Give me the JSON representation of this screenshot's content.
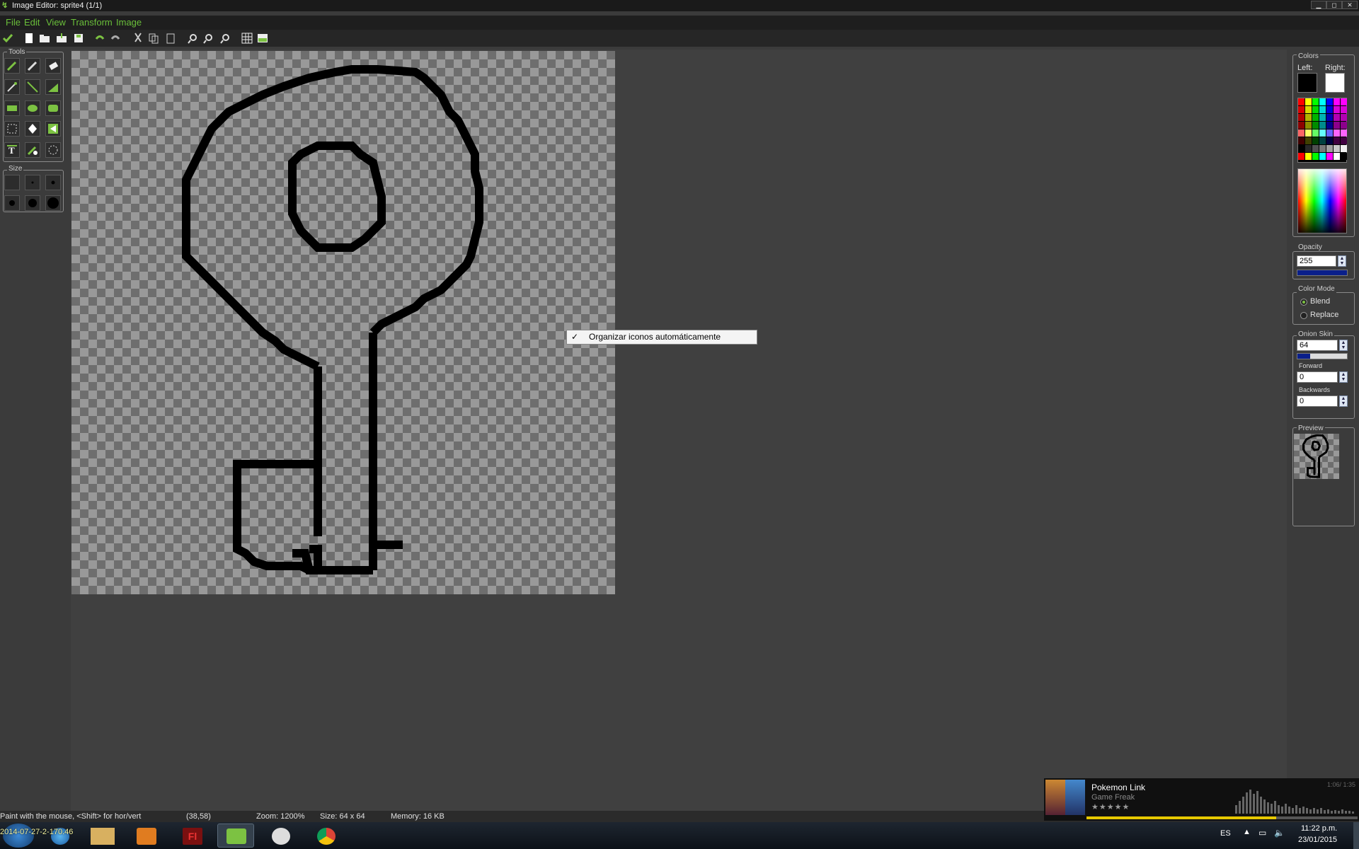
{
  "window": {
    "title": "Image Editor: sprite4 (1/1)",
    "controls": [
      "▁",
      "◻",
      "✕"
    ]
  },
  "menu": [
    "File",
    "Edit",
    "View",
    "Transform",
    "Image"
  ],
  "left_panel": {
    "tools_label": "Tools",
    "size_label": "Size"
  },
  "context_menu": {
    "check": "✓",
    "item": "Organizar iconos automáticamente"
  },
  "right_panel": {
    "colors_label": "Colors",
    "left_label": "Left:",
    "right_label": "Right:",
    "left_color": "#000000",
    "right_color": "#ffffff",
    "opacity_label": "Opacity",
    "opacity_value": "255",
    "opacity_level": 1.0,
    "color_mode_label": "Color Mode",
    "blend_label": "Blend",
    "replace_label": "Replace",
    "color_mode_selected": "Blend",
    "onion_label": "Onion Skin",
    "onion_value": "64",
    "onion_level": 0.25,
    "forward_label": "Forward",
    "forward_value": "0",
    "backwards_label": "Backwards",
    "backwards_value": "0",
    "preview_label": "Preview"
  },
  "status": {
    "hint": "Paint with the mouse, <Shift> for hor/vert",
    "coords": "(38,58)",
    "zoom": "Zoom: 1200%",
    "size": "Size: 64 x 64",
    "memory": "Memory: 16 KB"
  },
  "music": {
    "track": "Pokemon Link",
    "artist": "Game Freak",
    "rating": "★★★★★",
    "time": "1:06/ 1:35",
    "progress": 0.7
  },
  "taskbar": {
    "overlay_text": "2014-07-27-2-170.46",
    "lang": "ES",
    "time": "11:22 p.m.",
    "date": "23/01/2015"
  },
  "colors": {
    "accent_green": "#6abf3a",
    "selection_blue": "#0a1f8a"
  }
}
